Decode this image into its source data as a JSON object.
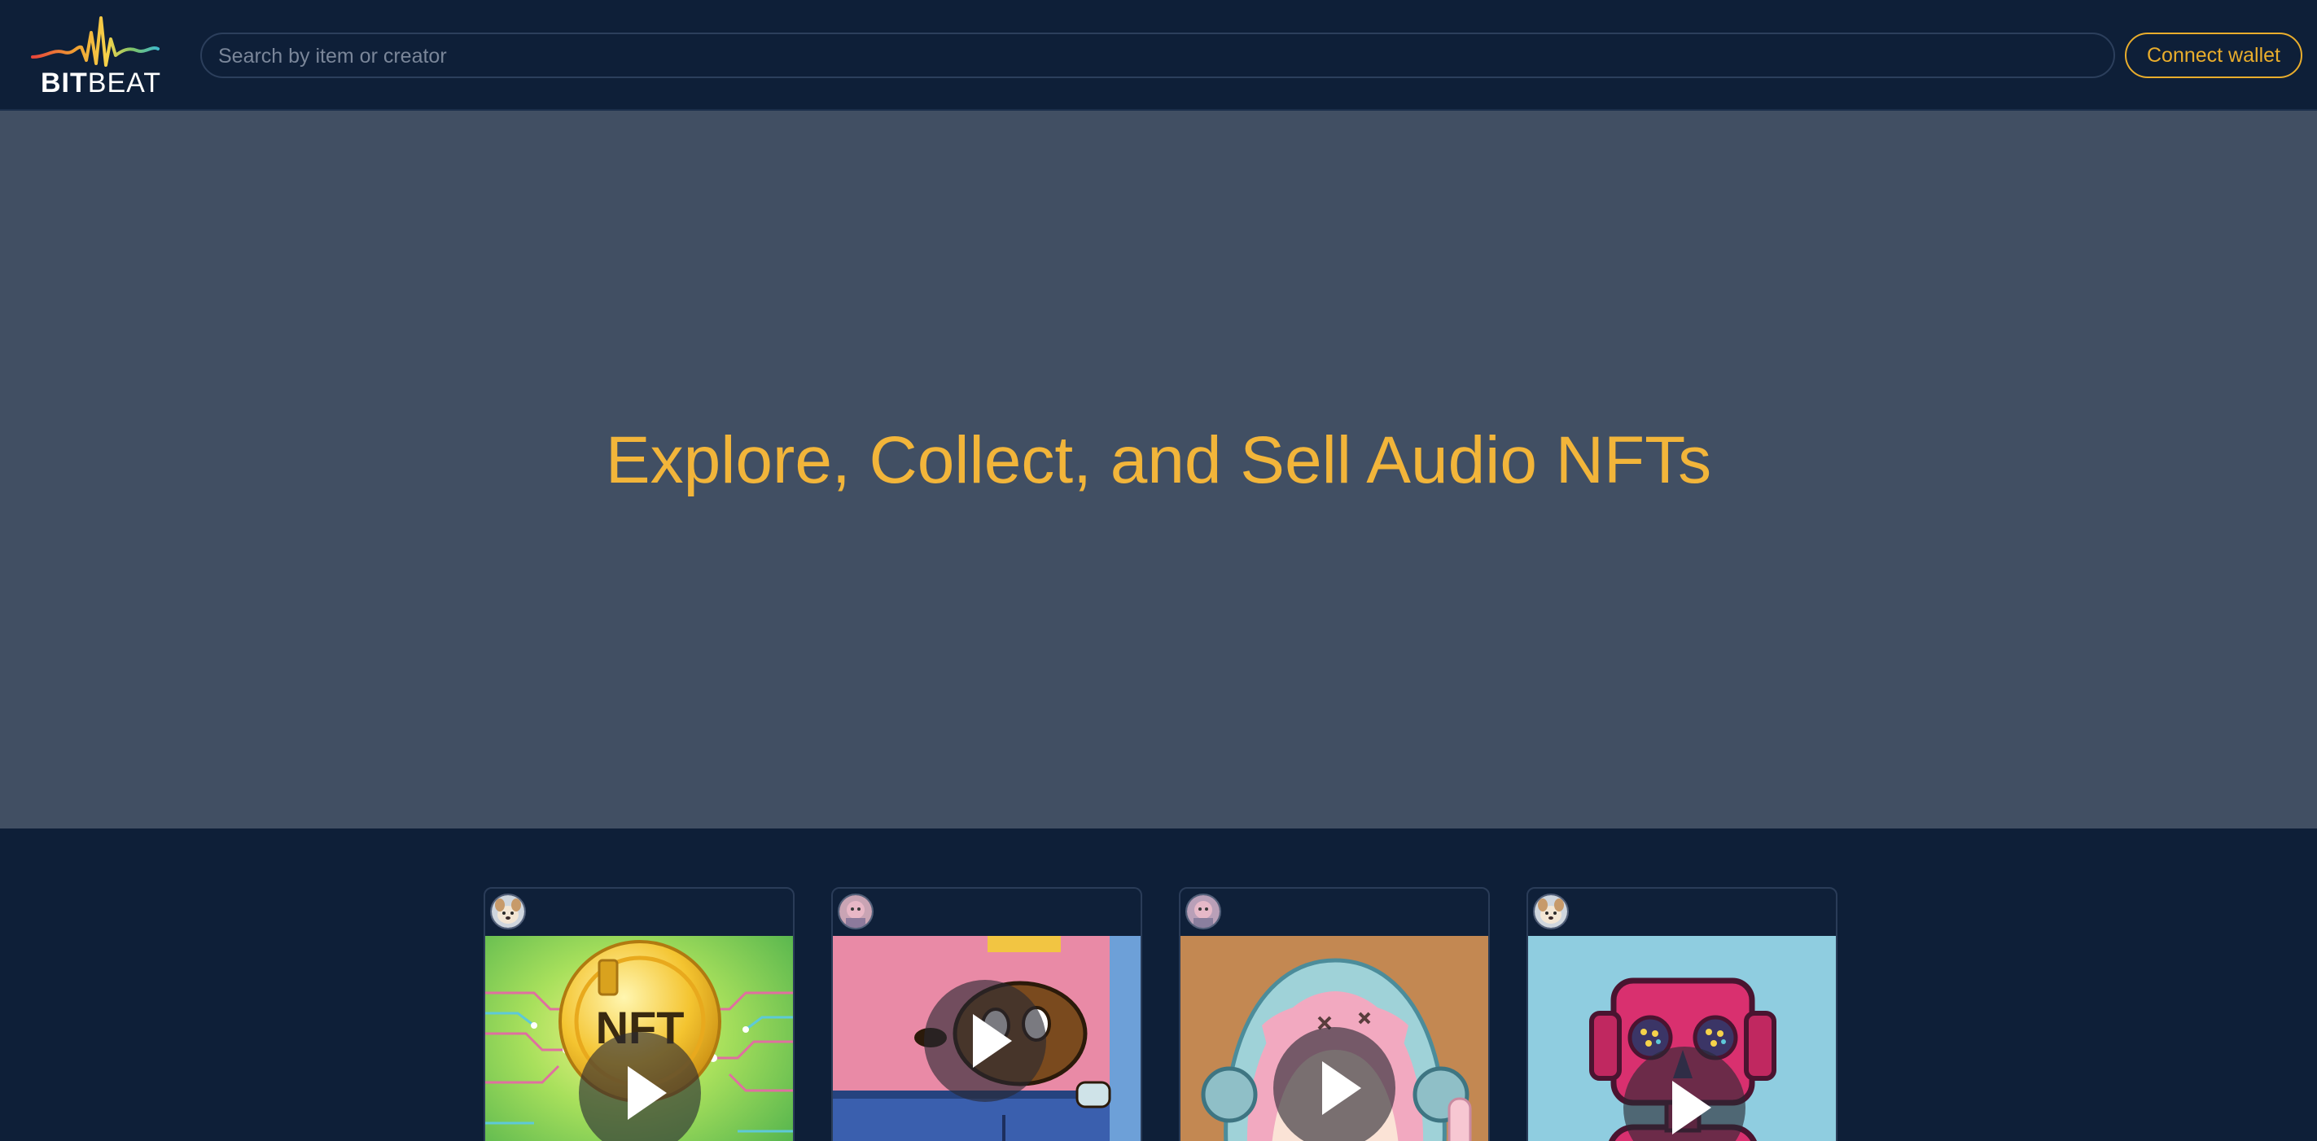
{
  "brand": {
    "name_bold": "BIT",
    "name_light": "BEAT",
    "wave_colors": [
      "#e8443a",
      "#f0a132",
      "#f6d34a",
      "#7cc36a",
      "#3fb8c9"
    ]
  },
  "search": {
    "placeholder": "Search by item or creator",
    "value": ""
  },
  "header": {
    "connect_wallet_label": "Connect wallet"
  },
  "hero": {
    "title": "Explore, Collect, and Sell Audio NFTs"
  },
  "colors": {
    "accent": "#e9ad2c",
    "hero_title": "#f2b53a",
    "background": "#0e1f38",
    "hero_background": "#414f63"
  },
  "cards": [
    {
      "id": "nft-coin",
      "artwork": "gold NFT coin on green circuit background",
      "avatar": "creator-avatar-dog"
    },
    {
      "id": "cartoon-room",
      "artwork": "cartoon dog in a pink room",
      "avatar": "creator-avatar-pink"
    },
    {
      "id": "anime-headphones",
      "artwork": "pink-haired anime character with headphones",
      "avatar": "creator-avatar-pink"
    },
    {
      "id": "robot",
      "artwork": "magenta robot with headphones",
      "avatar": "creator-avatar-dog"
    }
  ]
}
